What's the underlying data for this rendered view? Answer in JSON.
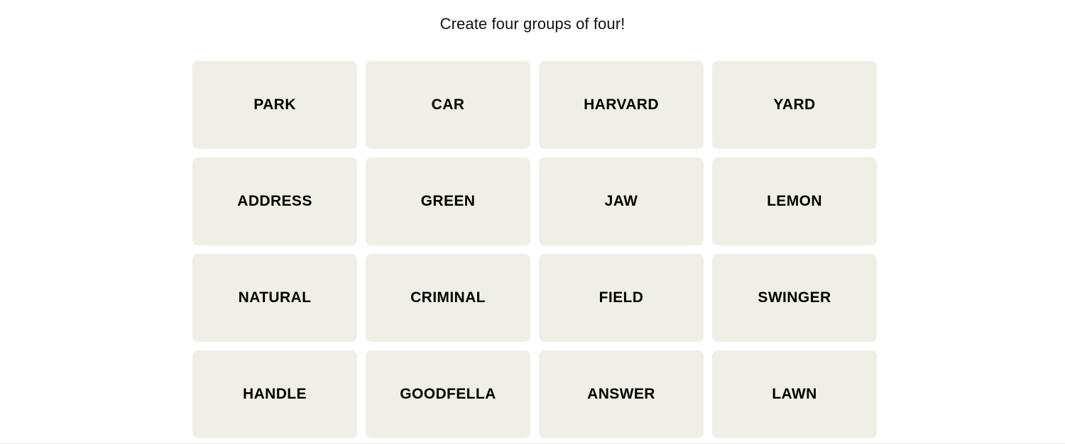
{
  "header": {
    "title": "Create four groups of four!"
  },
  "colors": {
    "page_background": "#ffffff",
    "tile_background": "#efefe6",
    "tile_text": "#000000",
    "title_text": "#121212",
    "bottom_border": "#e8e8e8"
  },
  "board": {
    "rows": 4,
    "columns": 4,
    "tiles": [
      {
        "word": "PARK"
      },
      {
        "word": "CAR"
      },
      {
        "word": "HARVARD"
      },
      {
        "word": "YARD"
      },
      {
        "word": "ADDRESS"
      },
      {
        "word": "GREEN"
      },
      {
        "word": "JAW"
      },
      {
        "word": "LEMON"
      },
      {
        "word": "NATURAL"
      },
      {
        "word": "CRIMINAL"
      },
      {
        "word": "FIELD"
      },
      {
        "word": "SWINGER"
      },
      {
        "word": "HANDLE"
      },
      {
        "word": "GOODFELLA"
      },
      {
        "word": "ANSWER"
      },
      {
        "word": "LAWN"
      }
    ]
  }
}
